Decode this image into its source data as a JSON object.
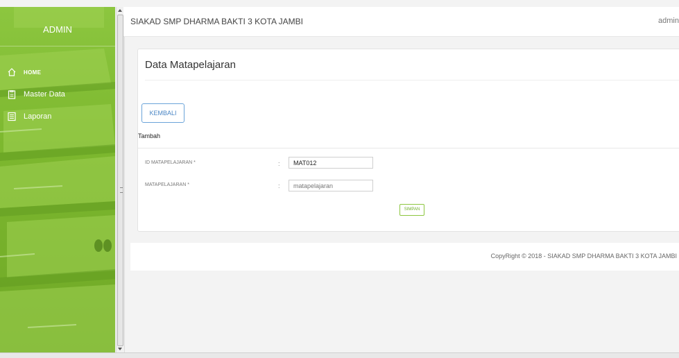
{
  "sidebar": {
    "brand": "ADMIN",
    "items": [
      {
        "label": "HOME",
        "icon": "home-icon"
      },
      {
        "label": "Master Data",
        "icon": "clipboard-icon"
      },
      {
        "label": "Laporan",
        "icon": "report-icon"
      }
    ]
  },
  "header": {
    "title": "SIAKAD SMP DHARMA BAKTI 3 KOTA JAMBI",
    "user": "admin"
  },
  "panel": {
    "title": "Data Matapelajaran",
    "back_label": "KEMBALI",
    "section": "Tambah",
    "fields": [
      {
        "label": "ID MATAPELAJARAN *",
        "colon": ":",
        "value": "MAT012",
        "placeholder": ""
      },
      {
        "label": "MATAPELAJARAN *",
        "colon": ":",
        "value": "",
        "placeholder": "matapelajaran"
      }
    ],
    "save_label": "SIMPAN"
  },
  "footer": {
    "text": "CopyRight © 2018 - SIAKAD SMP DHARMA BAKTI 3 KOTA JAMBI"
  },
  "colors": {
    "sidebar_green": "#8cc63f",
    "accent_blue": "#4a86c5"
  }
}
